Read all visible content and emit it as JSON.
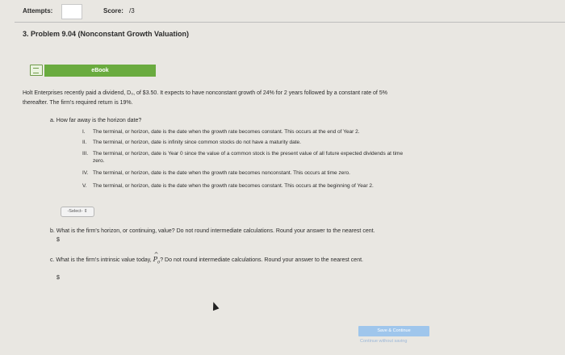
{
  "header": {
    "attempts_label": "Attempts:",
    "score_label": "Score:",
    "score_value": "/3"
  },
  "problem_title": "3. Problem 9.04 (Nonconstant Growth Valuation)",
  "ebook_label": "eBook",
  "intro": "Holt Enterprises recently paid a dividend, D₀, of $3.50. It expects to have nonconstant growth of 24% for 2 years followed by a constant rate of 5%",
  "intro_cont": "thereafter. The firm's required return is 19%.",
  "part_a": {
    "question": "a. How far away is the horizon date?",
    "options": [
      {
        "num": "I.",
        "text": "The terminal, or horizon, date is the date when the growth rate becomes constant. This occurs at the end of Year 2."
      },
      {
        "num": "II.",
        "text": "The terminal, or horizon, date is infinity since common stocks do not have a maturity date."
      },
      {
        "num": "III.",
        "text": "The terminal, or horizon, date is Year 0 since the value of a common stock is the present value of all future expected dividends at time",
        "text_cont": "zero."
      },
      {
        "num": "IV.",
        "text": "The terminal, or horizon, date is the date when the growth rate becomes nonconstant. This occurs at time zero."
      },
      {
        "num": "V.",
        "text": "The terminal, or horizon, date is the date when the growth rate becomes constant. This occurs at the beginning of Year 2."
      }
    ],
    "select_label": "-Select- ⇕"
  },
  "part_b": {
    "question": "b. What is the firm's horizon, or continuing, value? Do not round intermediate calculations. Round your answer to the nearest cent.",
    "currency": "$"
  },
  "part_c": {
    "q_before": "c. What is the firm's intrinsic value today, ",
    "p_symbol": "P",
    "p_sub": "0",
    "q_after": "? Do not round intermediate calculations. Round your answer to the nearest cent.",
    "currency": "$"
  },
  "footer": {
    "save_continue": "Save & Continue",
    "continue_without_saving": "Continue without saving"
  }
}
